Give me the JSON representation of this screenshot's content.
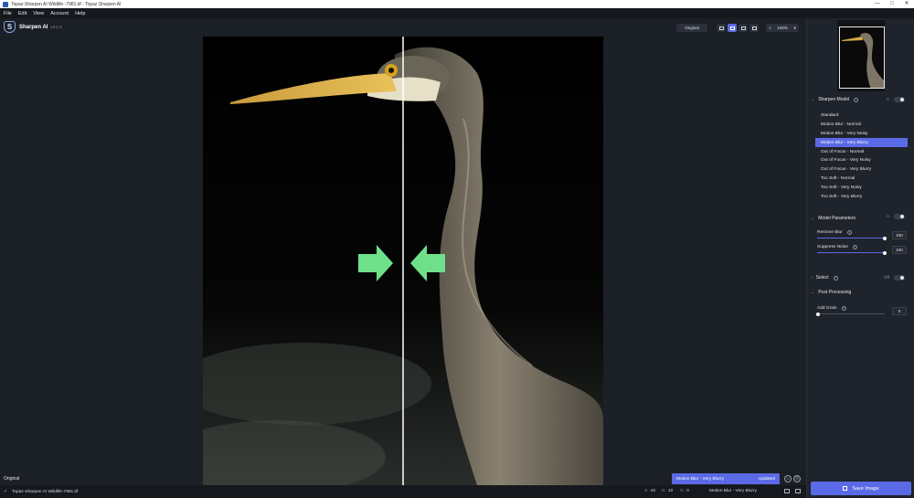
{
  "window": {
    "title": "Topaz-Sharpen AI Wildlife -7981.tif - Topaz Sharpen AI",
    "controls": [
      "—",
      "□",
      "✕"
    ]
  },
  "menu": [
    "File",
    "Edit",
    "View",
    "Account",
    "Help"
  ],
  "brand": {
    "logo_letter": "S",
    "name": "Sharpen AI",
    "version": "v4.1.0"
  },
  "toolbar": {
    "original_label": "Original",
    "zoom": "100%",
    "zoom_icon": "magnifier-icon"
  },
  "canvas": {
    "left_label": "Original"
  },
  "preview_status": {
    "model": "Motion Blur - Very Blurry",
    "state": "Updated"
  },
  "statusbar": {
    "check": "✓",
    "filename": "Topaz-Sharpen AI Wildlife-7981.tif",
    "metrics": [
      {
        "key": "S:",
        "value": "43"
      },
      {
        "key": "N:",
        "value": "10"
      },
      {
        "key": "G:",
        "value": "0"
      }
    ],
    "model": "Motion Blur - Very Blurry"
  },
  "sharpen_model": {
    "title": "Sharpen Model",
    "help": "?",
    "toggle_label": "A",
    "items": [
      "Standard",
      "Motion Blur - Normal",
      "Motion Blur - Very Noisy",
      "Motion Blur - Very Blurry",
      "Out of Focus - Normal",
      "Out of Focus - Very Noisy",
      "Out of Focus - Very Blurry",
      "Too Soft - Normal",
      "Too Soft - Very Noisy",
      "Too Soft - Very Blurry"
    ],
    "selected_index": 3
  },
  "model_parameters": {
    "title": "Model Parameters",
    "toggle_label": "A",
    "remove_blur": {
      "label": "Remove Blur",
      "value": "100",
      "fraction": 1.0
    },
    "suppress_noise": {
      "label": "Suppress Noise",
      "value": "100",
      "fraction": 1.0
    }
  },
  "select": {
    "title": "Select",
    "toggle_label": "Off"
  },
  "post_processing": {
    "title": "Post Processing",
    "add_grain": {
      "label": "Add Grain",
      "value": "0",
      "fraction": 0.0
    }
  },
  "save_button": {
    "label": "Save Image"
  },
  "colors": {
    "accent": "#5a6ae6",
    "panel": "#1f232b",
    "background": "#1b1f26",
    "arrow": "#6fe08a"
  }
}
